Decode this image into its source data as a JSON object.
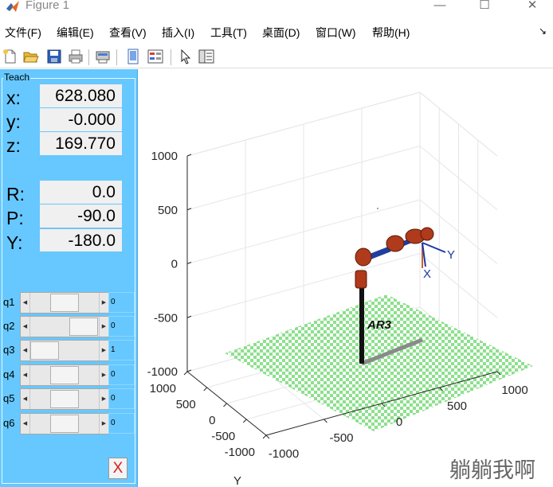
{
  "window": {
    "title": "Figure 1",
    "controls": {
      "minimize": "—",
      "maximize": "☐",
      "close": "✕"
    }
  },
  "menu": {
    "items": [
      "文件(F)",
      "编辑(E)",
      "查看(V)",
      "插入(I)",
      "工具(T)",
      "桌面(D)",
      "窗口(W)",
      "帮助(H)"
    ],
    "dock_arrow": "↘"
  },
  "toolbar": {
    "icons": [
      "new-figure-icon",
      "open-file-icon",
      "save-icon",
      "print-icon",
      "print-preview-icon",
      "link-plot-icon",
      "legend-icon",
      "pointer-icon",
      "property-inspector-icon"
    ]
  },
  "teach": {
    "title": "Teach",
    "position": [
      {
        "label": "x:",
        "value": "628.080"
      },
      {
        "label": "y:",
        "value": "-0.000"
      },
      {
        "label": "z:",
        "value": "169.770"
      }
    ],
    "orientation": [
      {
        "label": "R:",
        "value": "0.0"
      },
      {
        "label": "P:",
        "value": "-90.0"
      },
      {
        "label": "Y:",
        "value": "-180.0"
      }
    ],
    "joints": [
      {
        "label": "q1",
        "value": "0",
        "level": 0.5
      },
      {
        "label": "q2",
        "value": "0",
        "level": 0.97
      },
      {
        "label": "q3",
        "value": "1",
        "level": 0.0
      },
      {
        "label": "q4",
        "value": "0",
        "level": 0.5
      },
      {
        "label": "q5",
        "value": "0",
        "level": 0.5
      },
      {
        "label": "q6",
        "value": "0",
        "level": 0.5
      }
    ],
    "close_label": "X"
  },
  "plot": {
    "z_ticks": [
      "1000",
      "500",
      "0",
      "-500",
      "-1000"
    ],
    "x_ticks": [
      "1000",
      "500",
      "0",
      "-500",
      "-1000"
    ],
    "y_ticks": [
      "1000",
      "500",
      "0",
      "-500",
      "-1000"
    ],
    "y_axis_label": "Y",
    "robot_name": "AR3",
    "frame_x_label": "X",
    "frame_y_label": "Y",
    "colors": {
      "floor_green": "#8de08d",
      "robot_link": "#1f3f9e",
      "robot_joint": "#b03a1c",
      "frame_axis": "#1a3aa8"
    }
  },
  "watermark": "躺躺我啊"
}
